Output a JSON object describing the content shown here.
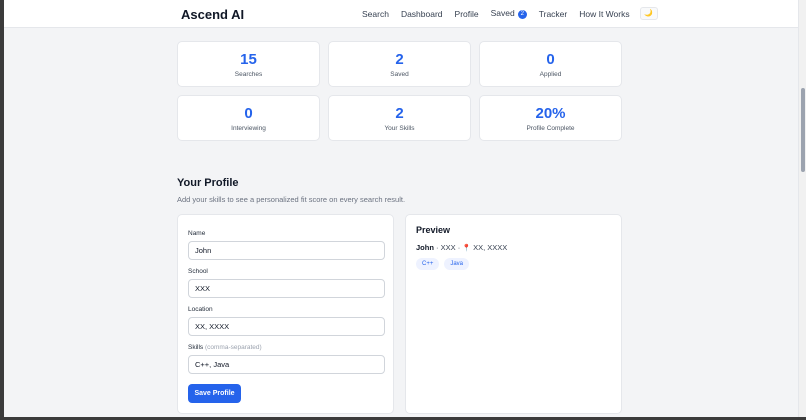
{
  "header": {
    "brand": "Ascend AI",
    "nav": [
      "Search",
      "Dashboard",
      "Profile",
      "Saved",
      "Tracker",
      "How It Works"
    ],
    "saved_count": "2",
    "theme_icon": "moon-icon"
  },
  "stats": [
    {
      "value": "15",
      "label": "Searches"
    },
    {
      "value": "2",
      "label": "Saved"
    },
    {
      "value": "0",
      "label": "Applied"
    },
    {
      "value": "0",
      "label": "Interviewing"
    },
    {
      "value": "2",
      "label": "Your Skills"
    },
    {
      "value": "20%",
      "label": "Profile Complete"
    }
  ],
  "profile": {
    "title": "Your Profile",
    "subtitle": "Add your skills to see a personalized fit score on every search result.",
    "fields": {
      "name_label": "Name",
      "name_value": "John",
      "school_label": "School",
      "school_value": "XXX",
      "location_label": "Location",
      "location_value": "XX, XXXX",
      "skills_label": "Skills",
      "skills_hint": "(comma-separated)",
      "skills_value": "C++, Java"
    },
    "save_label": "Save Profile"
  },
  "preview": {
    "title": "Preview",
    "name": "John",
    "school": "XXX",
    "location": "XX, XXXX",
    "separator": "·",
    "skills": [
      "C++",
      "Java"
    ]
  },
  "colors": {
    "accent": "#2563eb",
    "background": "#f3f4f6",
    "card": "#ffffff"
  }
}
